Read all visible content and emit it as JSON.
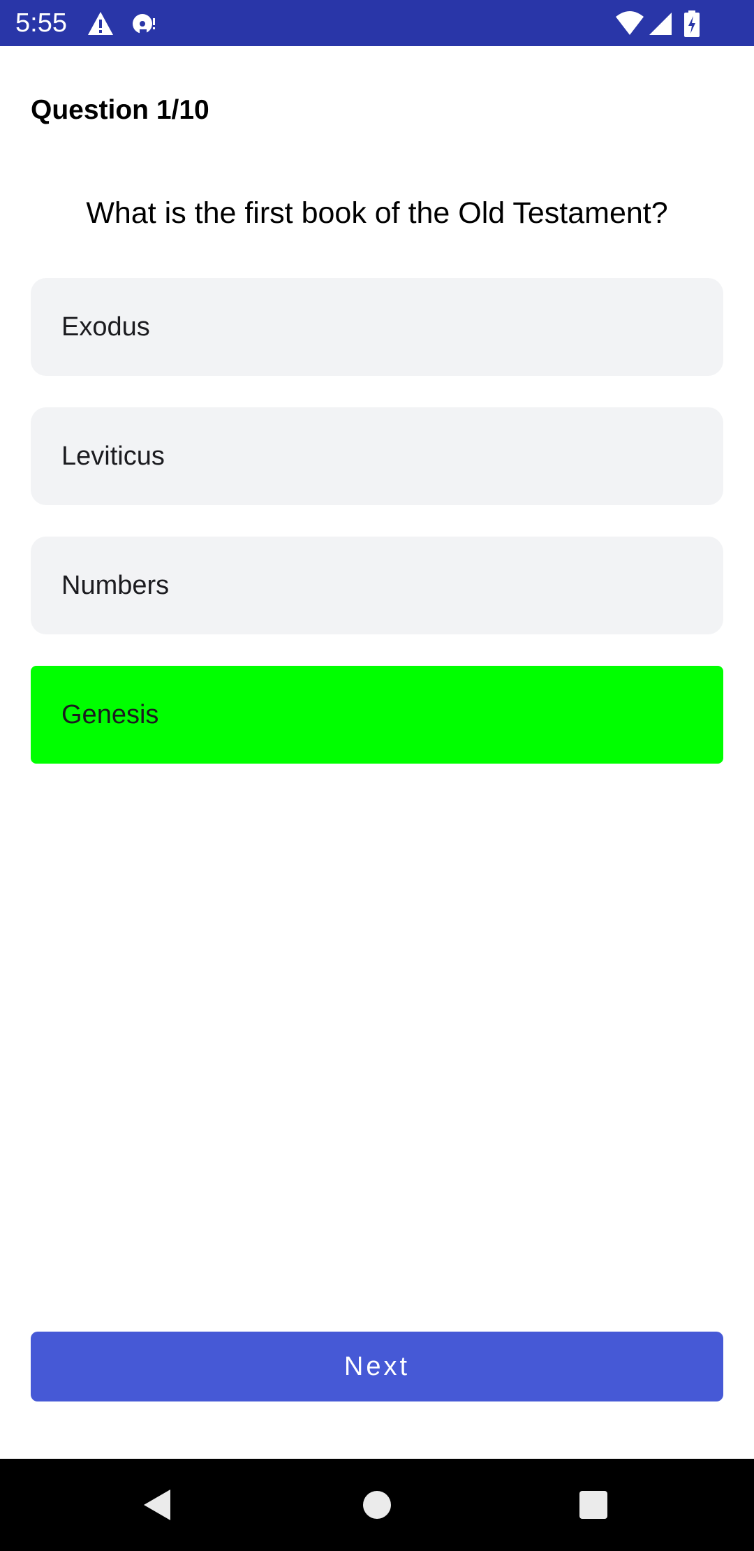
{
  "status_bar": {
    "time": "5:55",
    "background_color": "#2936a8",
    "left_icons": [
      "warning-icon",
      "sync-disc-icon"
    ],
    "right_icons": [
      "wifi-icon",
      "cell-signal-icon",
      "battery-charging-icon"
    ]
  },
  "quiz": {
    "counter": "Question 1/10",
    "question": "What is the first book of the Old Testament?",
    "options": [
      {
        "label": "Exodus",
        "selected": false
      },
      {
        "label": "Leviticus",
        "selected": false
      },
      {
        "label": "Numbers",
        "selected": false
      },
      {
        "label": "Genesis",
        "selected": true
      }
    ],
    "option_bg_color": "#f2f3f5",
    "selected_color": "#00ff00",
    "next_label": "Next",
    "next_color": "#4659d6"
  },
  "nav_bar": {
    "buttons": [
      "back-icon",
      "home-icon",
      "recents-icon"
    ]
  }
}
